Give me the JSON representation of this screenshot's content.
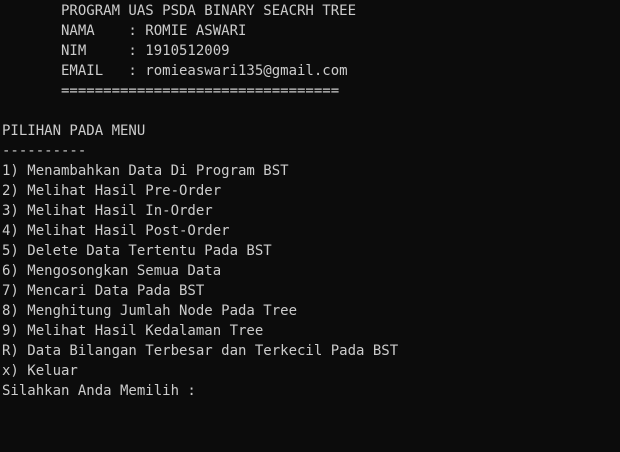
{
  "colors": {
    "background": "#0c0c0c",
    "text": "#cccccc"
  },
  "header": {
    "title": "       PROGRAM UAS PSDA BINARY SEACRH TREE",
    "nama": "       NAMA    : ROMIE ASWARI",
    "nim": "       NIM     : 1910512009",
    "email": "       EMAIL   : romieaswari135@gmail.com",
    "rule": "       ================================="
  },
  "menu": {
    "heading": "PILIHAN PADA MENU",
    "underline": "----------",
    "items": [
      "1) Menambahkan Data Di Program BST",
      "2) Melihat Hasil Pre-Order",
      "3) Melihat Hasil In-Order",
      "4) Melihat Hasil Post-Order",
      "5) Delete Data Tertentu Pada BST",
      "6) Mengosongkan Semua Data",
      "7) Mencari Data Pada BST",
      "8) Menghitung Jumlah Node Pada Tree",
      "9) Melihat Hasil Kedalaman Tree",
      "R) Data Bilangan Terbesar dan Terkecil Pada BST",
      "x) Keluar"
    ],
    "prompt": "Silahkan Anda Memilih : "
  }
}
